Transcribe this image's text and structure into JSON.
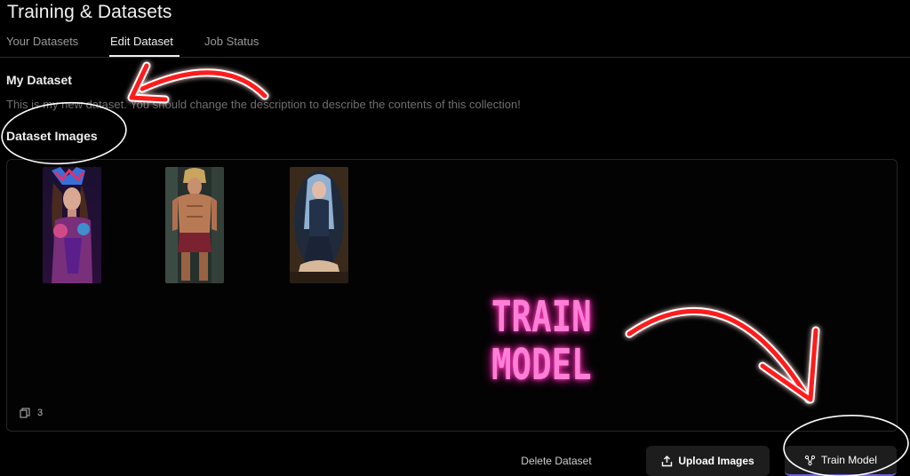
{
  "header": {
    "title": "Training & Datasets"
  },
  "tabs": [
    {
      "label": "Your Datasets"
    },
    {
      "label": "Edit Dataset"
    },
    {
      "label": "Job Status"
    }
  ],
  "dataset": {
    "name": "My Dataset",
    "description": "This is my new dataset. You should change the description to describe the contents of this collection!"
  },
  "images_section": {
    "heading": "Dataset Images",
    "count": "3",
    "images": [
      {
        "alt": "fantasy woman with feathered headdress"
      },
      {
        "alt": "muscular barbarian warrior"
      },
      {
        "alt": "woman in dark costume kneeling"
      }
    ]
  },
  "actions": {
    "delete_label": "Delete Dataset",
    "upload_label": "Upload Images",
    "train_label": "Train Model"
  },
  "annotation": {
    "line1": "TRAIN",
    "line2": "MODEL"
  },
  "colors": {
    "accent": "#6d5fd6",
    "annotation_red": "#ff2020",
    "annotation_pink": "#ff7fd6"
  }
}
